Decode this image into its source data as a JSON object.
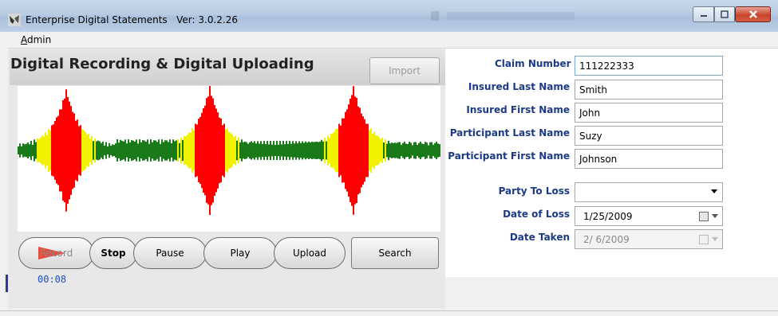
{
  "window": {
    "title": "Enterprise Digital Statements",
    "version_label": "Ver: 3.0.2.26"
  },
  "menu": {
    "items": [
      {
        "mnemonic": "A",
        "rest": "dmin"
      }
    ]
  },
  "panel": {
    "title": "Digital Recording & Digital Uploading",
    "import_label": "Import"
  },
  "transport": {
    "record_label": "Record",
    "stop_label": "Stop",
    "pause_label": "Pause",
    "play_label": "Play",
    "upload_label": "Upload",
    "search_label": "Search",
    "elapsed": "00:08"
  },
  "form": {
    "claim_number": {
      "label": "Claim Number",
      "value": "111222333"
    },
    "insured_last": {
      "label": "Insured Last Name",
      "value": "Smith"
    },
    "insured_first": {
      "label": "Insured First Name",
      "value": "John"
    },
    "participant_last": {
      "label": "Participant Last Name",
      "value": "Suzy"
    },
    "participant_first": {
      "label": "Participant First Name",
      "value": "Johnson"
    },
    "party_to_loss": {
      "label": "Party To Loss",
      "value": ""
    },
    "date_of_loss": {
      "label": "Date of Loss",
      "value": "1/25/2009"
    },
    "date_taken": {
      "label": "Date Taken",
      "value": "2/ 6/2009"
    }
  },
  "colors": {
    "wave_low": "#1a7a1a",
    "wave_mid": "#f2f200",
    "wave_high": "#ff0000",
    "label_blue": "#1d3a86",
    "timer_blue": "#1d4fd6"
  }
}
